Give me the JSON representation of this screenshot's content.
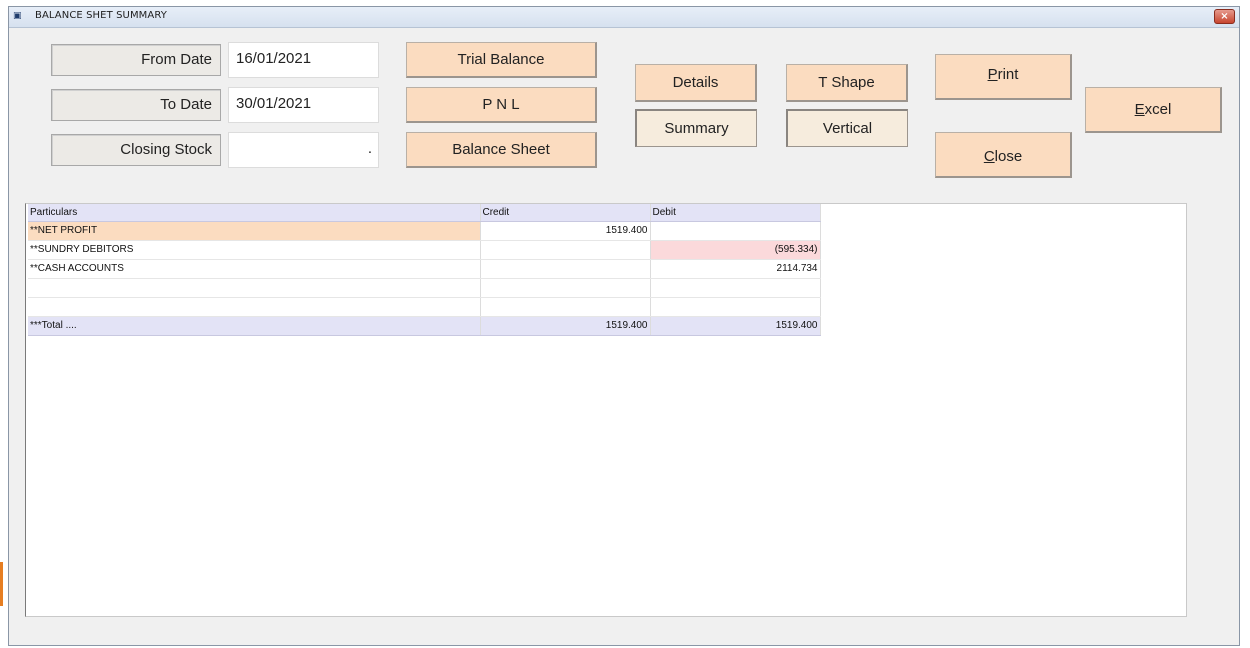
{
  "window": {
    "title": "BALANCE SHET SUMMARY",
    "close_label": "×"
  },
  "form": {
    "from_date_label": "From Date",
    "from_date_value": "16/01/2021",
    "to_date_label": "To Date",
    "to_date_value": "30/01/2021",
    "closing_stock_label": "Closing Stock",
    "closing_stock_value": "."
  },
  "buttons": {
    "trial_balance": "Trial Balance",
    "pnl": "P N L",
    "balance_sheet": "Balance Sheet",
    "details": "Details",
    "summary": "Summary",
    "t_shape": "T Shape",
    "vertical": "Vertical",
    "print_hotkey": "P",
    "print_rest": "rint",
    "close_hotkey": "C",
    "close_rest": "lose",
    "excel_hotkey": "E",
    "excel_rest": "xcel"
  },
  "table": {
    "columns": [
      "Particulars",
      "Credit",
      "Debit"
    ],
    "rows": [
      {
        "particulars": "**NET PROFIT",
        "credit": "1519.400",
        "debit": ""
      },
      {
        "particulars": "**SUNDRY DEBITORS",
        "credit": "",
        "debit": "(595.334)"
      },
      {
        "particulars": "**CASH ACCOUNTS",
        "credit": "",
        "debit": "2114.734"
      },
      {
        "particulars": "",
        "credit": "",
        "debit": ""
      },
      {
        "particulars": "",
        "credit": "",
        "debit": ""
      }
    ],
    "total": {
      "particulars": "***Total ....",
      "credit": "1519.400",
      "debit": "1519.400"
    }
  },
  "colors": {
    "button_accent": "#fbdcc0",
    "header_row": "#e3e3f6",
    "negative_cell": "#fbd9db",
    "close_button": "#c7452f"
  }
}
